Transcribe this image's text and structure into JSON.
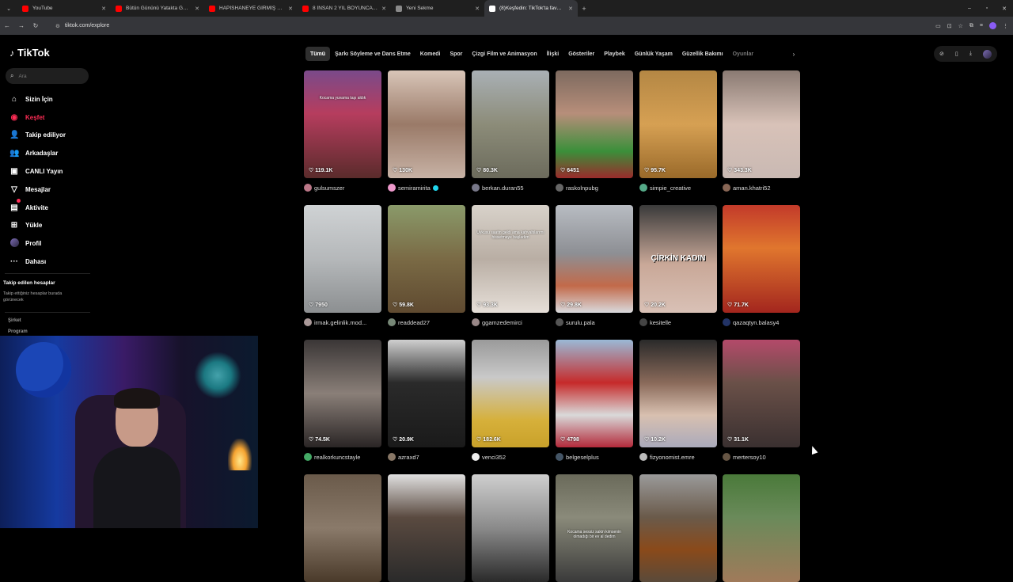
{
  "browser": {
    "tabs": [
      {
        "title": "YouTube",
        "color": "#ff0000",
        "active": false
      },
      {
        "title": "Bütün Gününü Yatakta Geçiriyo",
        "color": "#ff0000",
        "active": false
      },
      {
        "title": "HAPİSHANEYE GİRMİŞ HANIM",
        "color": "#ff0000",
        "active": false
      },
      {
        "title": "8 İNSAN 2 YIL BOYUNCA BİR M",
        "color": "#ff0000",
        "active": false
      },
      {
        "title": "Yeni Sekme",
        "color": "#8a8a8a",
        "active": false
      },
      {
        "title": "(8)Keşfedin: TikTok'ta favori vid",
        "color": "#ffffff",
        "active": true
      }
    ],
    "url": "tiktok.com/explore"
  },
  "sidebar": {
    "logo": "TikTok",
    "search_placeholder": "Ara",
    "items": [
      {
        "label": "Sizin İçin",
        "icon": "home-icon",
        "glyph": "⌂"
      },
      {
        "label": "Keşfet",
        "icon": "compass-icon",
        "glyph": "◉",
        "active": true
      },
      {
        "label": "Takip ediliyor",
        "icon": "following-icon",
        "glyph": "👤"
      },
      {
        "label": "Arkadaşlar",
        "icon": "friends-icon",
        "glyph": "👥"
      },
      {
        "label": "CANLI Yayın",
        "icon": "live-icon",
        "glyph": "▣"
      },
      {
        "label": "Mesajlar",
        "icon": "messages-icon",
        "glyph": "▽"
      },
      {
        "label": "Aktivite",
        "icon": "activity-icon",
        "glyph": "▤"
      },
      {
        "label": "Yükle",
        "icon": "upload-icon",
        "glyph": "⊞"
      },
      {
        "label": "Profil",
        "icon": "profile-icon",
        "glyph": ""
      },
      {
        "label": "Dahası",
        "icon": "more-icon",
        "glyph": "···"
      }
    ],
    "followed_title": "Takip edilen hesaplar",
    "followed_subtitle": "Takip ettiğiniz hesaplar burada görünecek",
    "company": "Şirket",
    "program": "Program"
  },
  "categories": [
    "Tümü",
    "Şarkı Söyleme ve Dans Etme",
    "Komedi",
    "Spor",
    "Çizgi Film ve Animasyon",
    "İlişki",
    "Gösteriler",
    "Playbek",
    "Günlük Yaşam",
    "Güzellik Bakımı",
    "Oyunlar"
  ],
  "videos": [
    {
      "likes": "119.1K",
      "user": "gulsumszer",
      "bg": "linear-gradient(180deg,#7a4a8a 0%,#b63d5e 40%,#5a2b2b 100%)",
      "av": "#b78",
      "caption": "Kocama yuvama taşı aldık"
    },
    {
      "likes": "130K",
      "user": "semiramirita",
      "verified": true,
      "bg": "linear-gradient(180deg,#d8c5b8 0%,#9a7a68 50%,#c7b2a5 100%)",
      "av": "#e9c"
    },
    {
      "likes": "80.3K",
      "user": "berkan.duran55",
      "bg": "linear-gradient(180deg,#a9b0b5 0%,#8c8c79 50%,#6c6b5c 100%)",
      "av": "#778"
    },
    {
      "likes": "6451",
      "user": "raskolnpubg",
      "bg": "linear-gradient(180deg,#7d6a5f 0%,#b78e7a 40%,#3b8f3a 75%,#9a2b2b 100%)",
      "av": "#666"
    },
    {
      "likes": "95.7K",
      "user": "simpie_creative",
      "bg": "linear-gradient(180deg,#b48744 0%,#d6a053 50%,#9a6a2a 100%)",
      "av": "#5a8"
    },
    {
      "likes": "343.3K",
      "user": "aman.khatri52",
      "bg": "linear-gradient(180deg,#8a7a72 0%,#d8c2b8 50%,#c9b9b3 100%)",
      "av": "#865"
    },
    {
      "likes": "7950",
      "user": "irmak.gelinlik.mod...",
      "bg": "linear-gradient(180deg,#cfd2d4 0%,#b5b8ba 50%,#8c8f91 100%)",
      "av": "#a99"
    },
    {
      "likes": "59.8K",
      "user": "readdead27",
      "bg": "linear-gradient(180deg,#8a9a6a 0%,#7a6a45 50%,#5f4a30 100%)",
      "av": "#787"
    },
    {
      "likes": "93.3K",
      "user": "ggamzedemirci",
      "bg": "linear-gradient(180deg,#d8d2ca 0%,#b9aea4 50%,#e6dfd8 100%)",
      "av": "#988",
      "caption": "Uykusu saatin geldi ama kahvaltılarımı hissetmeye başladım"
    },
    {
      "likes": "29.8K",
      "user": "surulu.pala",
      "bg": "linear-gradient(180deg,#b8bcc2 0%,#8d8f94 45%,#c26a4a 75%,#d9dadd 100%)",
      "av": "#555"
    },
    {
      "likes": "20.2K",
      "user": "kesitelle",
      "bg": "linear-gradient(180deg,#3a3a3a 0%,#c9a898 55%,#d9c1b6 100%)",
      "av": "#444",
      "big": "ÇİRKİN KADIN"
    },
    {
      "likes": "71.7K",
      "user": "qazaqtyn.balasy4",
      "bg": "linear-gradient(180deg,#c23a2a 0%,#e0762e 40%,#a3261e 100%)",
      "av": "#236"
    },
    {
      "likes": "74.5K",
      "user": "realkorkuncstayle",
      "bg": "linear-gradient(180deg,#3a3636 0%,#8a7f78 50%,#2a2525 100%)",
      "av": "#4a6"
    },
    {
      "likes": "20.9K",
      "user": "azraxd7",
      "bg": "linear-gradient(180deg,#cfcfcf 0%,#2a2a2a 40%,#1a1a1a 100%)",
      "av": "#876"
    },
    {
      "likes": "182.6K",
      "user": "venci352",
      "bg": "linear-gradient(180deg,#9a9a9a 0%,#c9c9c9 35%,#d6b03a 75%,#c9a12a 100%)",
      "av": "#eee"
    },
    {
      "likes": "4798",
      "user": "belgeselplus",
      "bg": "linear-gradient(180deg,#9ab9d6 0%,#c62a2a 40%,#d9d9d9 70%,#b32a3a 100%)",
      "av": "#456"
    },
    {
      "likes": "10.2K",
      "user": "fizyonomist.emre",
      "bg": "linear-gradient(180deg,#2a2a2a 0%,#8a6a5a 40%,#d8c0b0 70%,#aab 100%)",
      "av": "#bbb"
    },
    {
      "likes": "31.1K",
      "user": "mertersoy10",
      "bg": "linear-gradient(180deg,#b44a6a 0%,#6a5048 40%,#3a3030 100%)",
      "av": "#654"
    },
    {
      "likes": "",
      "user": "",
      "bg": "linear-gradient(180deg,#6a5a4a 0%,#8a7a6a 50%,#4a3a2a 100%)",
      "av": "#000"
    },
    {
      "likes": "",
      "user": "",
      "bg": "linear-gradient(180deg,#e0e0e0 0%,#5a4a40 40%,#2a2a2a 100%)",
      "av": "#000"
    },
    {
      "likes": "",
      "user": "",
      "bg": "linear-gradient(180deg,#cfcfcf 0%,#8a8a8a 50%,#2a2a2a 100%)",
      "av": "#000"
    },
    {
      "likes": "",
      "user": "",
      "bg": "linear-gradient(180deg,#6a6a5a 0%,#8a8a7a 40%,#3a3a3a 100%)",
      "av": "#000",
      "caption": "Kocama sessiz sakin kimsenin olmadığı bir ev al dedim"
    },
    {
      "likes": "",
      "user": "",
      "bg": "linear-gradient(180deg,#9a9a9a 0%,#6a5a4a 40%,#8a4a1a 70%,#5a4a3a 100%)",
      "av": "#000"
    },
    {
      "likes": "",
      "user": "",
      "bg": "linear-gradient(180deg,#4a7a3a 0%,#6a8a5a 40%,#a07a5a 100%)",
      "av": "#000"
    }
  ]
}
